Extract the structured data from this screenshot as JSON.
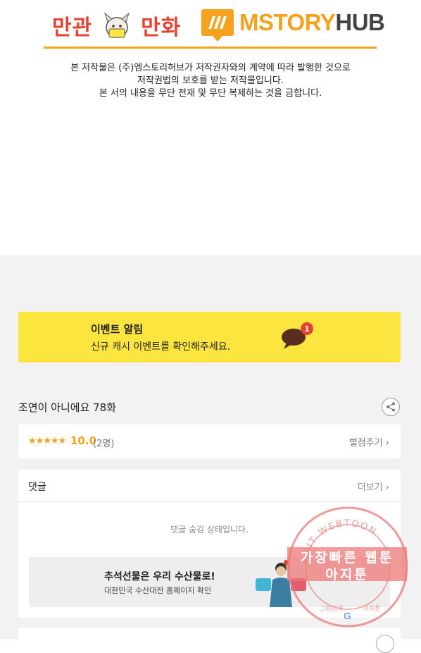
{
  "header": {
    "logo_left_part1": "만관",
    "logo_left_part2": "만화",
    "logo_right_part1": "MSTORY",
    "logo_right_part2": "HUB",
    "copyright_lines": [
      "본 저작물은 (주)엠스토리허브가 저작권자와의 계약에 따라 발행한 것으로",
      "저작권법의 보호를 받는 저작물입니다.",
      "본 서의 내용을 무단 전재 및 무단 복제하는 것을 금합니다."
    ]
  },
  "event": {
    "title": "이벤트 알림",
    "subtitle": "신규 캐시 이벤트를 확인해주세요.",
    "badge_count": "1"
  },
  "episode": {
    "title": "조연이 아니에요 78화"
  },
  "rating": {
    "stars": "★★★★★",
    "score": "10.0",
    "count": "(2명)",
    "rate_button": "별점주기 ›"
  },
  "comments": {
    "heading": "댓글",
    "more": "더보기 ›",
    "hidden_message": "댓글 숨김 상태입니다."
  },
  "ad": {
    "title": "추석선물은 우리 수산물로!",
    "subtitle": "대한민국 수산대전 홈페이지 확인"
  },
  "watermark": {
    "ring_text": "AGIT WEBTOON",
    "line1": "가장빠른 웹툰",
    "line2": "아지툰",
    "bottom_left": "그림검색",
    "bottom_right": "아지툰"
  },
  "colors": {
    "accent_orange": "#f6a21e",
    "event_yellow": "#fde53f",
    "badge_red": "#e8412f"
  }
}
